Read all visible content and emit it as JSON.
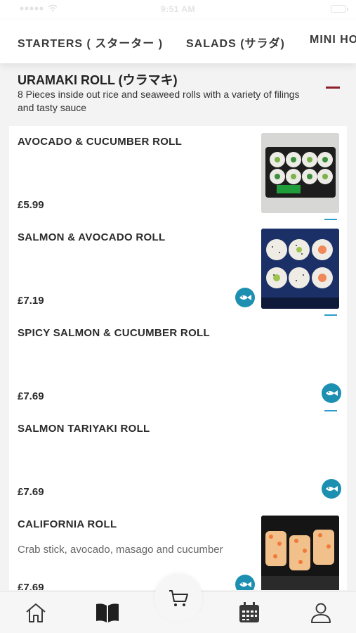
{
  "status_bar": {
    "time": "9:51 AM"
  },
  "category_tabs": [
    {
      "label": "STARTERS ( スターター )"
    },
    {
      "label": "SALADS (サラダ)"
    },
    {
      "label": "MINI HO"
    }
  ],
  "section": {
    "title": "URAMAKI ROLL (ウラマキ)",
    "description": "8 Pieces inside out rice and seaweed rolls with a variety of filings and tasty sauce"
  },
  "items": [
    {
      "name": "AVOCADO & CUCUMBER ROLL",
      "description": "",
      "price": "£5.99"
    },
    {
      "name": "SALMON & AVOCADO ROLL",
      "description": "",
      "price": "£7.19",
      "icon": "fish-icon"
    },
    {
      "name": "SPICY SALMON & CUCUMBER ROLL",
      "description": "",
      "price": "£7.69",
      "icon": "fish-icon"
    },
    {
      "name": "SALMON TARIYAKI ROLL",
      "description": "",
      "price": "£7.69",
      "icon": "fish-icon"
    },
    {
      "name": "CALIFORNIA ROLL",
      "description": "Crab stick, avocado, masago and cucumber",
      "price": "£7.69",
      "icon": "fish-icon"
    }
  ],
  "bottom_nav": [
    {
      "icon": "home-icon"
    },
    {
      "icon": "menu-book-icon"
    },
    {
      "icon": "cart-icon"
    },
    {
      "icon": "calendar-icon"
    },
    {
      "icon": "profile-icon"
    }
  ],
  "colors": {
    "accent": "#8e1f2c",
    "fish_badge": "#1d8fb0",
    "divider": "#2d9bcb"
  }
}
